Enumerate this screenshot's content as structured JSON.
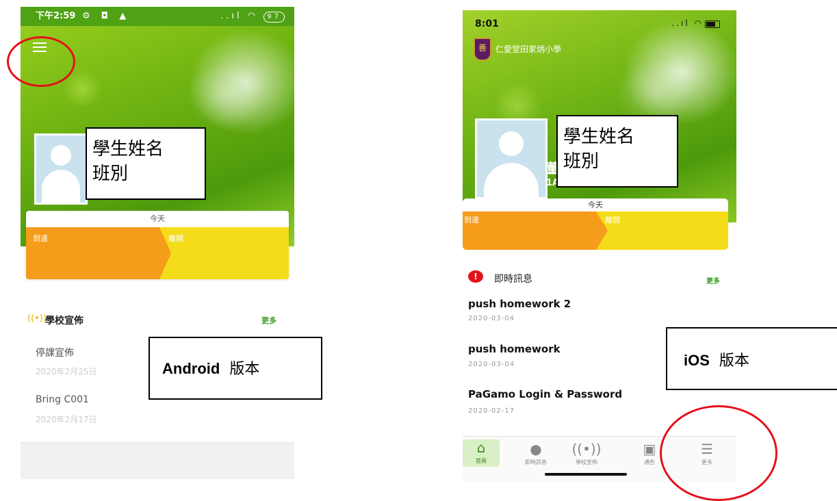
{
  "android": {
    "status": {
      "time": "下午2:59",
      "left_icons": "⚙ ◘ ▲",
      "right_icons": "..ıl ◠",
      "battery": "97"
    },
    "card": {
      "today": "今天",
      "arrive": "到達",
      "leave": "離開"
    },
    "announcements": {
      "title": "學校宣佈",
      "more": "更多",
      "items": [
        {
          "title": "停課宣佈",
          "date": "2020年2月25日"
        },
        {
          "title": "Bring C001",
          "date": "2020年2月17日"
        }
      ]
    }
  },
  "overlays": {
    "student_box_android": {
      "line1": "學生姓名",
      "line2": "班別"
    },
    "student_box_ios": {
      "line1": "學生姓名",
      "line2": "班別"
    },
    "android_version": {
      "bold": "Android",
      "text": "版本"
    },
    "ios_version": {
      "bold": "iOS",
      "text": "版本"
    }
  },
  "ios": {
    "status": {
      "time": "8:01",
      "signal": "..ıl ◠"
    },
    "school_name": "仁愛堂田家炳小學",
    "crest_glyph": "善",
    "name_peek": "董",
    "class_peek": "1A",
    "card": {
      "today": "今天",
      "arrive": "到達",
      "leave": "離開"
    },
    "messages": {
      "title": "即時訊息",
      "more": "更多",
      "items": [
        {
          "title": "push homework 2",
          "date": "2020-03-04"
        },
        {
          "title": "push homework",
          "date": "2020-03-04"
        },
        {
          "title": "PaGamo Login & Password",
          "date": "2020-02-17"
        }
      ]
    },
    "tabs": [
      {
        "label": "首頁",
        "icon": "home-icon"
      },
      {
        "label": "即時訊息",
        "icon": "message-icon"
      },
      {
        "label": "學校宣佈",
        "icon": "broadcast-icon"
      },
      {
        "label": "通告",
        "icon": "notice-icon"
      },
      {
        "label": "更多",
        "icon": "menu-icon"
      }
    ]
  },
  "colors": {
    "red_annotation": "#e3101a",
    "arrive": "#f59d1b",
    "leave": "#f5dc1a",
    "accent_green": "#3a9d23"
  }
}
